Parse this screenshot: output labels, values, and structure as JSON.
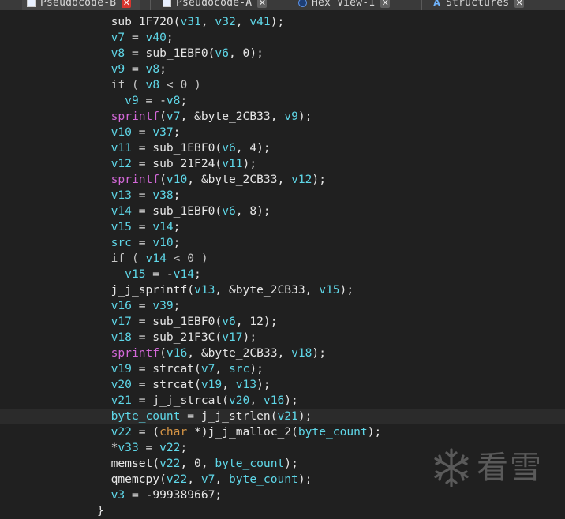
{
  "tabs": [
    {
      "label": "Pseudocode-B",
      "icon": "code-icon",
      "active": true
    },
    {
      "label": "Pseudocode-A",
      "icon": "code-icon",
      "active": false
    },
    {
      "label": "Hex View-1",
      "icon": "hex-view-icon",
      "active": false
    },
    {
      "label": "Structures",
      "icon": "structures-icon",
      "active": false
    }
  ],
  "close_glyph": "✕",
  "structures_glyph": "A",
  "colors": {
    "background": "#202020",
    "variable": "#5fd7e8",
    "call": "#d368d8",
    "keyword": "#d69545",
    "text": "#e6e6e6",
    "active_close": "#d9362f"
  },
  "code": {
    "lines": [
      {
        "indent": 16,
        "segs": [
          [
            "p",
            "sub_1F720("
          ],
          [
            "v",
            "v31"
          ],
          [
            "p",
            ", "
          ],
          [
            "v",
            "v32"
          ],
          [
            "p",
            ", "
          ],
          [
            "v",
            "v41"
          ],
          [
            "p",
            ");"
          ]
        ]
      },
      {
        "indent": 16,
        "segs": [
          [
            "v",
            "v7"
          ],
          [
            "p",
            " = "
          ],
          [
            "v",
            "v40"
          ],
          [
            "p",
            ";"
          ]
        ]
      },
      {
        "indent": 16,
        "segs": [
          [
            "v",
            "v8"
          ],
          [
            "p",
            " = sub_1EBF0("
          ],
          [
            "v",
            "v6"
          ],
          [
            "p",
            ", 0);"
          ]
        ]
      },
      {
        "indent": 16,
        "segs": [
          [
            "v",
            "v9"
          ],
          [
            "p",
            " = "
          ],
          [
            "v",
            "v8"
          ],
          [
            "p",
            ";"
          ]
        ]
      },
      {
        "indent": 16,
        "segs": [
          [
            "d",
            "if ( "
          ],
          [
            "v",
            "v8"
          ],
          [
            "d",
            " < 0 )"
          ]
        ]
      },
      {
        "indent": 18,
        "segs": [
          [
            "v",
            "v9"
          ],
          [
            "p",
            " = -"
          ],
          [
            "v",
            "v8"
          ],
          [
            "p",
            ";"
          ]
        ]
      },
      {
        "indent": 16,
        "segs": [
          [
            "c",
            "sprintf"
          ],
          [
            "p",
            "("
          ],
          [
            "v",
            "v7"
          ],
          [
            "p",
            ", &byte_2CB33, "
          ],
          [
            "v",
            "v9"
          ],
          [
            "p",
            ");"
          ]
        ]
      },
      {
        "indent": 16,
        "segs": [
          [
            "v",
            "v10"
          ],
          [
            "p",
            " = "
          ],
          [
            "v",
            "v37"
          ],
          [
            "p",
            ";"
          ]
        ]
      },
      {
        "indent": 16,
        "segs": [
          [
            "v",
            "v11"
          ],
          [
            "p",
            " = sub_1EBF0("
          ],
          [
            "v",
            "v6"
          ],
          [
            "p",
            ", 4);"
          ]
        ]
      },
      {
        "indent": 16,
        "segs": [
          [
            "v",
            "v12"
          ],
          [
            "p",
            " = sub_21F24("
          ],
          [
            "v",
            "v11"
          ],
          [
            "p",
            ");"
          ]
        ]
      },
      {
        "indent": 16,
        "segs": [
          [
            "c",
            "sprintf"
          ],
          [
            "p",
            "("
          ],
          [
            "v",
            "v10"
          ],
          [
            "p",
            ", &byte_2CB33, "
          ],
          [
            "v",
            "v12"
          ],
          [
            "p",
            ");"
          ]
        ]
      },
      {
        "indent": 16,
        "segs": [
          [
            "v",
            "v13"
          ],
          [
            "p",
            " = "
          ],
          [
            "v",
            "v38"
          ],
          [
            "p",
            ";"
          ]
        ]
      },
      {
        "indent": 16,
        "segs": [
          [
            "v",
            "v14"
          ],
          [
            "p",
            " = sub_1EBF0("
          ],
          [
            "v",
            "v6"
          ],
          [
            "p",
            ", 8);"
          ]
        ]
      },
      {
        "indent": 16,
        "segs": [
          [
            "v",
            "v15"
          ],
          [
            "p",
            " = "
          ],
          [
            "v",
            "v14"
          ],
          [
            "p",
            ";"
          ]
        ]
      },
      {
        "indent": 16,
        "segs": [
          [
            "v",
            "src"
          ],
          [
            "p",
            " = "
          ],
          [
            "v",
            "v10"
          ],
          [
            "p",
            ";"
          ]
        ]
      },
      {
        "indent": 16,
        "segs": [
          [
            "d",
            "if ( "
          ],
          [
            "v",
            "v14"
          ],
          [
            "d",
            " < 0 )"
          ]
        ]
      },
      {
        "indent": 18,
        "segs": [
          [
            "v",
            "v15"
          ],
          [
            "p",
            " = -"
          ],
          [
            "v",
            "v14"
          ],
          [
            "p",
            ";"
          ]
        ]
      },
      {
        "indent": 16,
        "segs": [
          [
            "p",
            "j_j_sprintf("
          ],
          [
            "v",
            "v13"
          ],
          [
            "p",
            ", &byte_2CB33, "
          ],
          [
            "v",
            "v15"
          ],
          [
            "p",
            ");"
          ]
        ]
      },
      {
        "indent": 16,
        "segs": [
          [
            "v",
            "v16"
          ],
          [
            "p",
            " = "
          ],
          [
            "v",
            "v39"
          ],
          [
            "p",
            ";"
          ]
        ]
      },
      {
        "indent": 16,
        "segs": [
          [
            "v",
            "v17"
          ],
          [
            "p",
            " = sub_1EBF0("
          ],
          [
            "v",
            "v6"
          ],
          [
            "p",
            ", 12);"
          ]
        ]
      },
      {
        "indent": 16,
        "segs": [
          [
            "v",
            "v18"
          ],
          [
            "p",
            " = sub_21F3C("
          ],
          [
            "v",
            "v17"
          ],
          [
            "p",
            ");"
          ]
        ]
      },
      {
        "indent": 16,
        "segs": [
          [
            "c",
            "sprintf"
          ],
          [
            "p",
            "("
          ],
          [
            "v",
            "v16"
          ],
          [
            "p",
            ", &byte_2CB33, "
          ],
          [
            "v",
            "v18"
          ],
          [
            "p",
            ");"
          ]
        ]
      },
      {
        "indent": 16,
        "segs": [
          [
            "v",
            "v19"
          ],
          [
            "p",
            " = strcat("
          ],
          [
            "v",
            "v7"
          ],
          [
            "p",
            ", "
          ],
          [
            "v",
            "src"
          ],
          [
            "p",
            ");"
          ]
        ]
      },
      {
        "indent": 16,
        "segs": [
          [
            "v",
            "v20"
          ],
          [
            "p",
            " = strcat("
          ],
          [
            "v",
            "v19"
          ],
          [
            "p",
            ", "
          ],
          [
            "v",
            "v13"
          ],
          [
            "p",
            ");"
          ]
        ]
      },
      {
        "indent": 16,
        "segs": [
          [
            "v",
            "v21"
          ],
          [
            "p",
            " = j_j_strcat("
          ],
          [
            "v",
            "v20"
          ],
          [
            "p",
            ", "
          ],
          [
            "v",
            "v16"
          ],
          [
            "p",
            ");"
          ]
        ]
      },
      {
        "indent": 16,
        "hl": true,
        "segs": [
          [
            "v",
            "byte_count"
          ],
          [
            "p",
            " = j_j_strlen("
          ],
          [
            "v",
            "v21"
          ],
          [
            "p",
            ");"
          ]
        ]
      },
      {
        "indent": 16,
        "segs": [
          [
            "v",
            "v22"
          ],
          [
            "p",
            " = ("
          ],
          [
            "k",
            "char"
          ],
          [
            "p",
            " *)j_j_malloc_2("
          ],
          [
            "v",
            "byte_count"
          ],
          [
            "p",
            ");"
          ]
        ]
      },
      {
        "indent": 16,
        "segs": [
          [
            "p",
            "*"
          ],
          [
            "v",
            "v33"
          ],
          [
            "p",
            " = "
          ],
          [
            "v",
            "v22"
          ],
          [
            "p",
            ";"
          ]
        ]
      },
      {
        "indent": 16,
        "segs": [
          [
            "p",
            "memset("
          ],
          [
            "v",
            "v22"
          ],
          [
            "p",
            ", 0, "
          ],
          [
            "v",
            "byte_count"
          ],
          [
            "p",
            ");"
          ]
        ]
      },
      {
        "indent": 16,
        "segs": [
          [
            "p",
            "qmemcpy("
          ],
          [
            "v",
            "v22"
          ],
          [
            "p",
            ", "
          ],
          [
            "v",
            "v7"
          ],
          [
            "p",
            ", "
          ],
          [
            "v",
            "byte_count"
          ],
          [
            "p",
            ");"
          ]
        ]
      },
      {
        "indent": 16,
        "segs": [
          [
            "v",
            "v3"
          ],
          [
            "p",
            " = -999389667;"
          ]
        ]
      },
      {
        "indent": 14,
        "segs": [
          [
            "p",
            "}"
          ]
        ]
      }
    ]
  },
  "watermark": {
    "text": "看雪",
    "icon": "snowflake-icon"
  }
}
